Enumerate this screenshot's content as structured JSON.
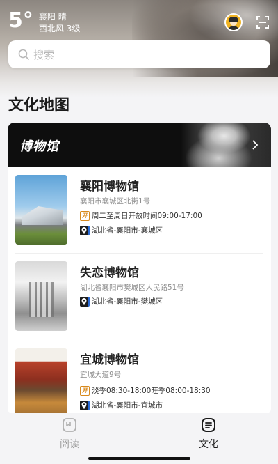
{
  "header": {
    "temperature": "5°",
    "city_weather": "襄阳 晴",
    "wind": "西北风 3级"
  },
  "search": {
    "placeholder": "搜索"
  },
  "section": {
    "title": "文化地图"
  },
  "banner": {
    "title": "博物馆"
  },
  "museums": [
    {
      "name": "襄阳博物馆",
      "address": "襄阳市襄城区北街1号",
      "hours": "周二至周日开放时间09:00-17:00",
      "region": "湖北省-襄阳市-襄城区",
      "open_badge": "开"
    },
    {
      "name": "失恋博物馆",
      "address": "湖北省襄阳市樊城区人民路51号",
      "region": "湖北省-襄阳市-樊城区"
    },
    {
      "name": "宜城博物馆",
      "address": "宜城大道9号",
      "hours": "淡季08:30-18:00旺季08:00-18:30",
      "region": "湖北省-襄阳市-宜城市",
      "open_badge": "开"
    }
  ],
  "tabs": [
    {
      "label": "阅读",
      "active": false
    },
    {
      "label": "文化",
      "active": true
    }
  ],
  "colors": {
    "accent_open": "#d88a1e",
    "tab_inactive": "#9a9a9a",
    "tab_active": "#1a1a1a"
  },
  "icons": [
    "avatar-icon",
    "scan-icon",
    "search-icon",
    "chevron-right-icon",
    "open-badge-icon",
    "location-icon",
    "book-icon",
    "culture-icon"
  ]
}
